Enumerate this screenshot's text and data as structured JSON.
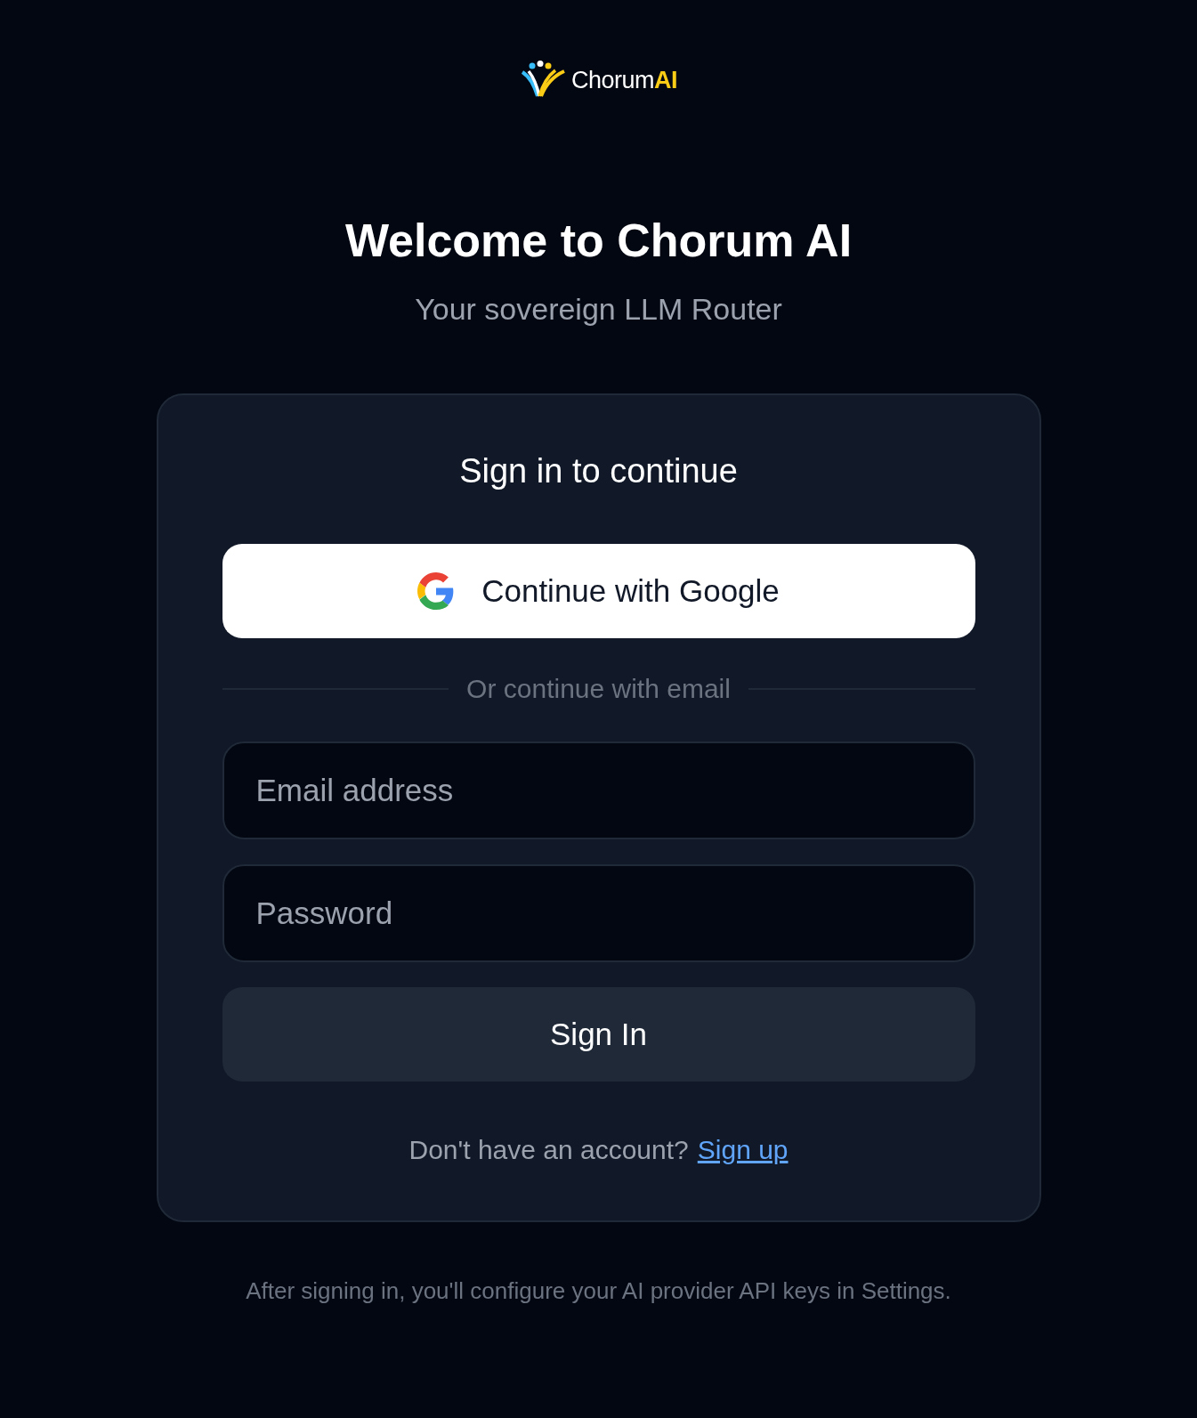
{
  "logo": {
    "name": "Chorum",
    "accent": "AI"
  },
  "title": "Welcome to Chorum AI",
  "subtitle": "Your sovereign LLM Router",
  "card": {
    "heading": "Sign in to continue",
    "google_button": "Continue with Google",
    "divider": "Or continue with email",
    "fields": [
      {
        "placeholder": "Email address"
      },
      {
        "placeholder": "Password"
      }
    ],
    "submit": "Sign In",
    "signup_prompt": "Don't have an account?",
    "signup_link": "Sign up"
  },
  "footer": "After signing in, you'll configure your AI provider API keys in Settings."
}
